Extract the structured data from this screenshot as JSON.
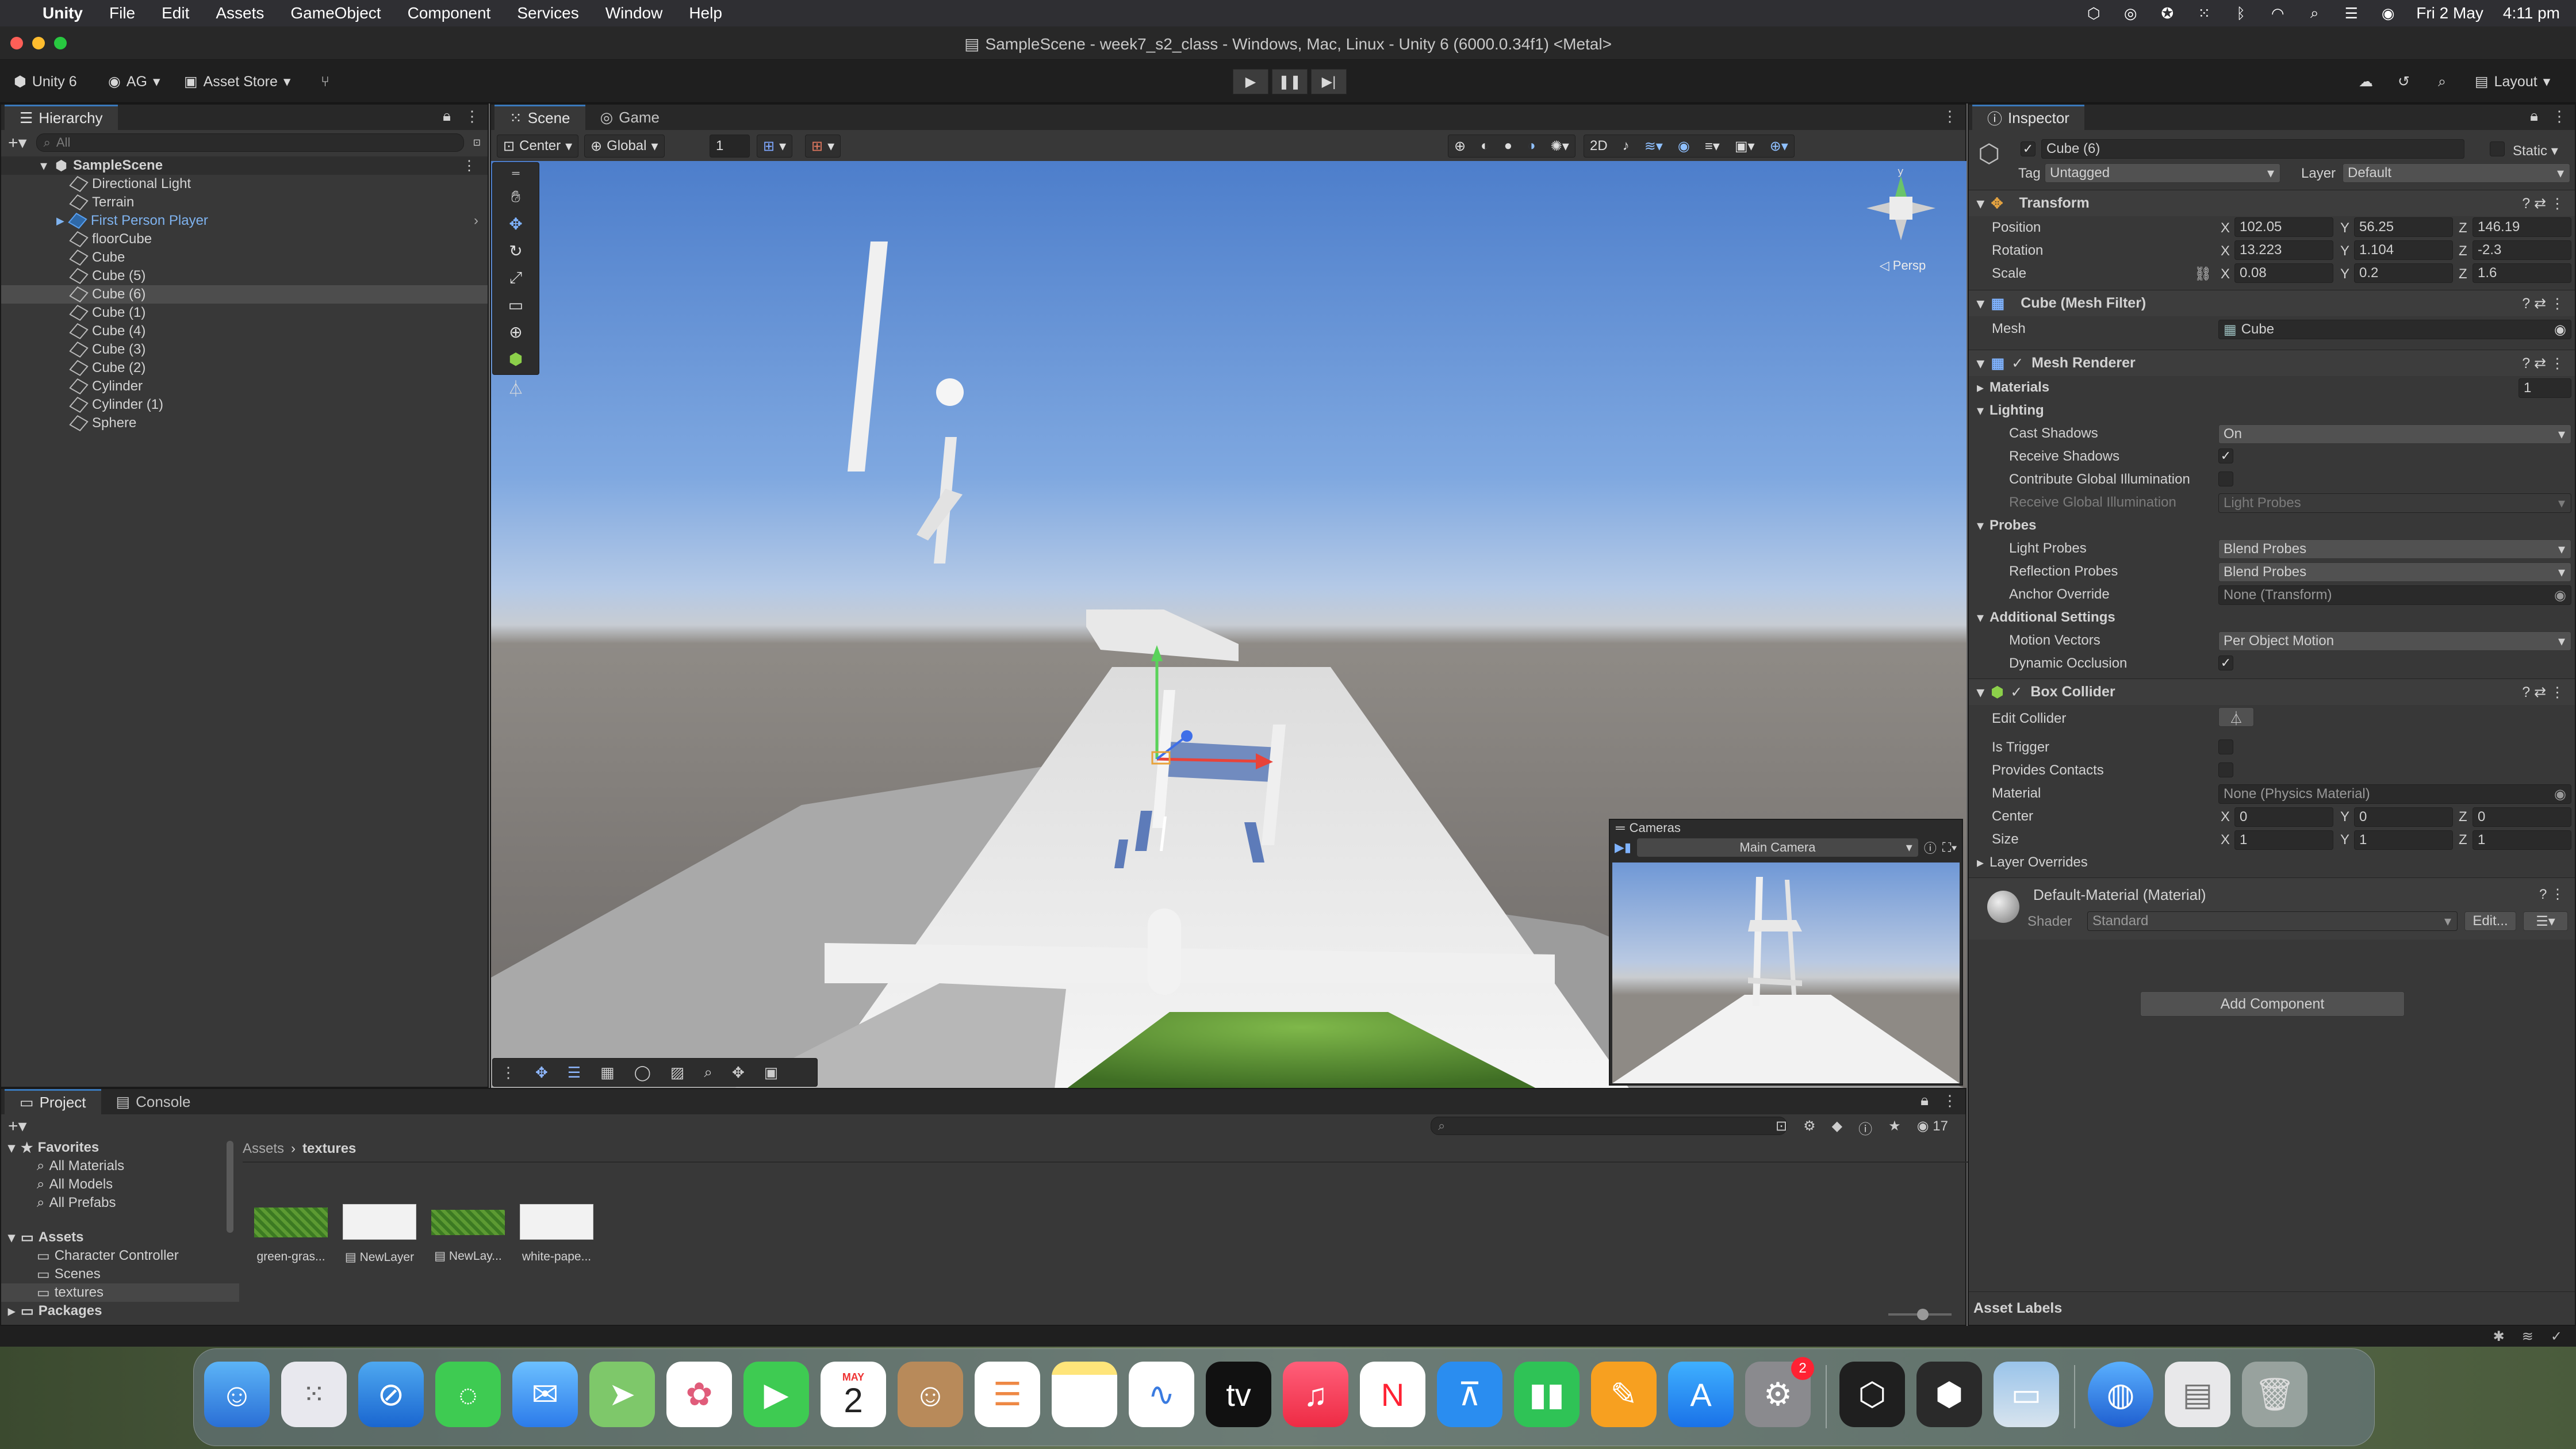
{
  "menubar": {
    "apple": "",
    "app": "Unity",
    "items": [
      "File",
      "Edit",
      "Assets",
      "GameObject",
      "Component",
      "Services",
      "Window",
      "Help"
    ],
    "date": "Fri 2 May",
    "time": "4:11 pm"
  },
  "window": {
    "title": "SampleScene - week7_s2_class - Windows, Mac, Linux - Unity 6 (6000.0.34f1) <Metal>"
  },
  "toolbar": {
    "unity": "Unity 6",
    "account": "AG",
    "asset_store": "Asset Store",
    "layout": "Layout"
  },
  "hierarchy": {
    "tab": "Hierarchy",
    "search_placeholder": "All",
    "scene": "SampleScene",
    "items": [
      "Directional Light",
      "Terrain",
      "First Person Player",
      "floorCube",
      "Cube",
      "Cube (5)",
      "Cube (6)",
      "Cube (1)",
      "Cube (4)",
      "Cube (3)",
      "Cube (2)",
      "Cylinder",
      "Cylinder (1)",
      "Sphere"
    ],
    "selected": "Cube (6)"
  },
  "scene": {
    "tabs": [
      "Scene",
      "Game"
    ],
    "pivot": "Center",
    "space": "Global",
    "grid_value": "1",
    "persp": "Persp",
    "overlay_title": "Cameras",
    "camera": "Main Camera"
  },
  "inspector": {
    "tab": "Inspector",
    "object": "Cube (6)",
    "static": "Static",
    "tag_label": "Tag",
    "tag": "Untagged",
    "layer_label": "Layer",
    "layer": "Default",
    "transform": {
      "title": "Transform",
      "position_label": "Position",
      "rotation_label": "Rotation",
      "scale_label": "Scale",
      "position": {
        "x": "102.05",
        "y": "56.25",
        "z": "146.19"
      },
      "rotation": {
        "x": "13.223",
        "y": "1.104",
        "z": "-2.3"
      },
      "scale": {
        "x": "0.08",
        "y": "0.2",
        "z": "1.6"
      }
    },
    "mesh_filter": {
      "title": "Cube (Mesh Filter)",
      "mesh_label": "Mesh",
      "mesh": "Cube"
    },
    "mesh_renderer": {
      "title": "Mesh Renderer",
      "materials": "Materials",
      "materials_count": "1",
      "lighting": "Lighting",
      "cast_shadows_label": "Cast Shadows",
      "cast_shadows": "On",
      "receive_shadows": "Receive Shadows",
      "contribute_gi": "Contribute Global Illumination",
      "receive_gi_label": "Receive Global Illumination",
      "receive_gi": "Light Probes",
      "probes": "Probes",
      "light_probes_label": "Light Probes",
      "light_probes": "Blend Probes",
      "reflection_probes_label": "Reflection Probes",
      "reflection_probes": "Blend Probes",
      "anchor_label": "Anchor Override",
      "anchor": "None (Transform)",
      "additional": "Additional Settings",
      "motion_label": "Motion Vectors",
      "motion": "Per Object Motion",
      "dynamic_occlusion": "Dynamic Occlusion"
    },
    "box_collider": {
      "title": "Box Collider",
      "edit_collider": "Edit Collider",
      "is_trigger": "Is Trigger",
      "provides_contacts": "Provides Contacts",
      "material_label": "Material",
      "material": "None (Physics Material)",
      "center_label": "Center",
      "center": {
        "x": "0",
        "y": "0",
        "z": "0"
      },
      "size_label": "Size",
      "size": {
        "x": "1",
        "y": "1",
        "z": "1"
      },
      "layer_overrides": "Layer Overrides"
    },
    "material": {
      "name": "Default-Material (Material)",
      "shader_label": "Shader",
      "shader": "Standard",
      "edit": "Edit..."
    },
    "add_component": "Add Component",
    "asset_labels": "Asset Labels"
  },
  "project": {
    "tabs": [
      "Project",
      "Console"
    ],
    "count": "17",
    "favorites": {
      "label": "Favorites",
      "items": [
        "All Materials",
        "All Models",
        "All Prefabs"
      ]
    },
    "assets": {
      "label": "Assets",
      "items": [
        "Character Controller",
        "Scenes",
        "textures"
      ]
    },
    "packages": "Packages",
    "breadcrumb": [
      "Assets",
      "textures"
    ],
    "files": [
      "green-gras...",
      "NewLayer",
      "NewLay...",
      "white-pape..."
    ]
  },
  "dock": {
    "calendar_month": "MAY",
    "calendar_day": "2",
    "badge": "2"
  }
}
